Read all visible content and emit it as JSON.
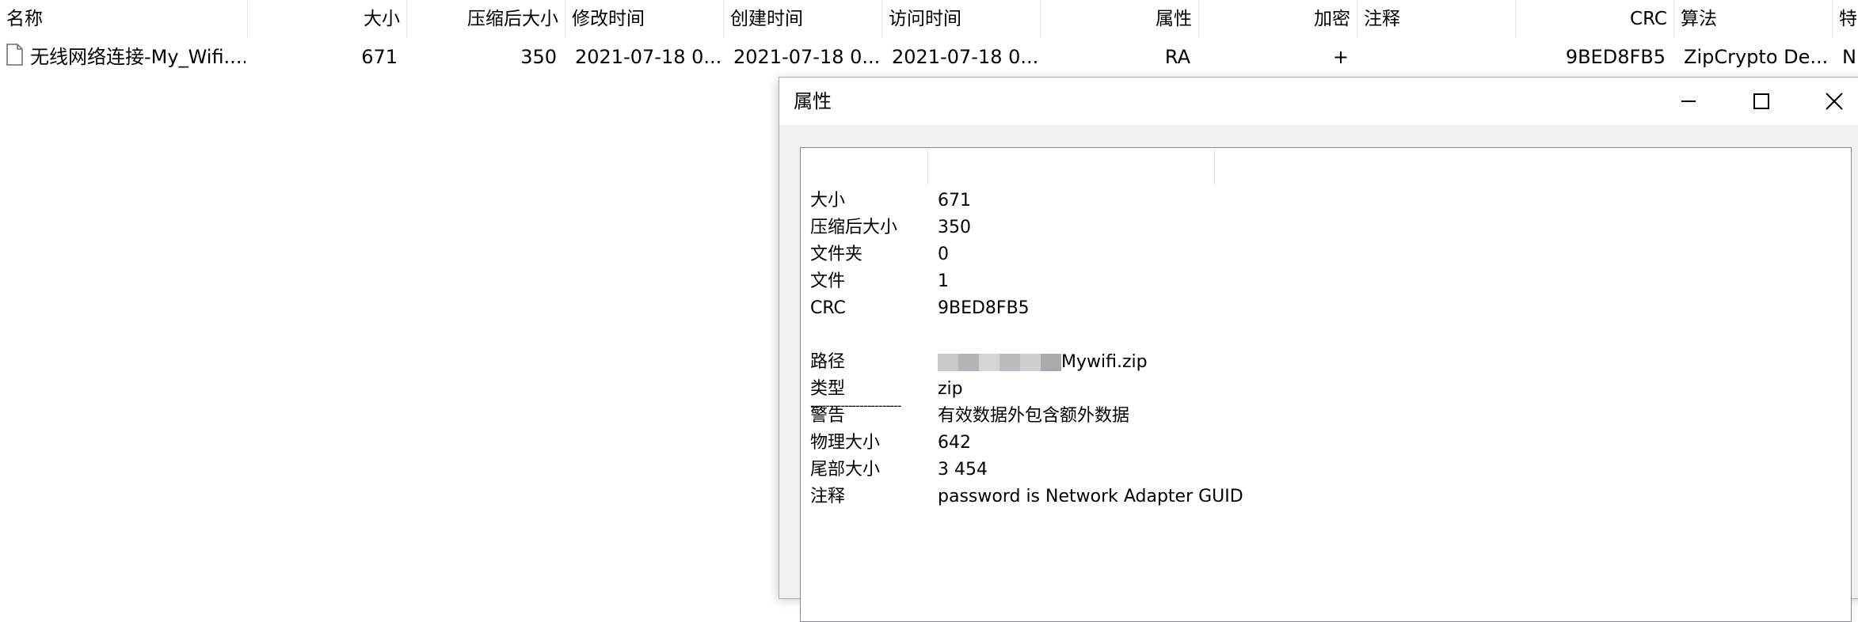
{
  "columns": {
    "name": "名称",
    "size": "大小",
    "packed": "压缩后大小",
    "modified": "修改时间",
    "created": "创建时间",
    "accessed": "访问时间",
    "attributes": "属性",
    "encrypted": "加密",
    "comment": "注释",
    "crc": "CRC",
    "method": "算法",
    "characteristics": "特"
  },
  "file_row": {
    "name": "无线网络连接-My_Wifi....",
    "size": "671",
    "packed": "350",
    "modified": "2021-07-18 0...",
    "created": "2021-07-18 0...",
    "accessed": "2021-07-18 0...",
    "attributes": "RA",
    "encrypted": "+",
    "comment": "",
    "crc": "9BED8FB5",
    "method": "ZipCrypto De...",
    "characteristics": "N"
  },
  "dialog": {
    "title": "属性",
    "separator": "------------------------",
    "props": [
      {
        "name": "大小",
        "value": "671"
      },
      {
        "name": "压缩后大小",
        "value": "350"
      },
      {
        "name": "文件夹",
        "value": "0"
      },
      {
        "name": "文件",
        "value": "1"
      },
      {
        "name": "CRC",
        "value": "9BED8FB5"
      }
    ],
    "props2": [
      {
        "name": "路径",
        "value": "Mywifi.zip"
      },
      {
        "name": "类型",
        "value": "zip"
      },
      {
        "name": "警告",
        "value": "有效数据外包含额外数据"
      },
      {
        "name": "物理大小",
        "value": "642"
      },
      {
        "name": "尾部大小",
        "value": "3 454"
      },
      {
        "name": "注释",
        "value": "password is Network Adapter GUID"
      }
    ]
  },
  "icons": {
    "file": "file-icon",
    "minimize": "minimize-icon",
    "maximize": "maximize-icon",
    "close": "close-icon"
  }
}
